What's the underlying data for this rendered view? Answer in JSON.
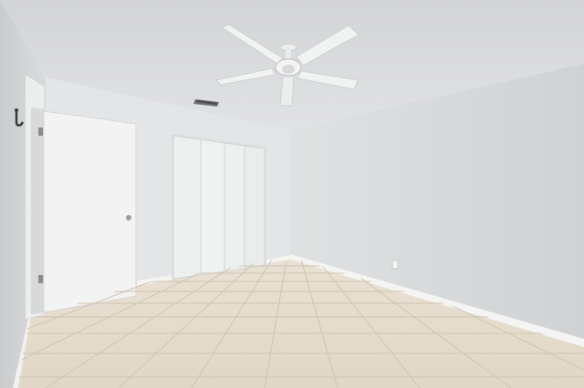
{
  "scene": {
    "kind": "empty bedroom photo",
    "colors": {
      "ceiling": "#dcdddf",
      "back_wall": "#e3e5e6",
      "right_wall": "#d6d8da",
      "left_wall": "#d2d4d6",
      "baseboard": "#f4f4f2",
      "floor_tile": "#e6dccd",
      "grout": "#cfc4b3",
      "door": "#f3f3f3",
      "closet": "#eef0f0",
      "fan_blade": "#f1f2f2"
    },
    "fixtures": {
      "ceiling_fan": "ceiling-fan-icon",
      "air_vent": "vent-icon",
      "wall_hook": "hook-icon",
      "outlet": "outlet-icon"
    }
  }
}
